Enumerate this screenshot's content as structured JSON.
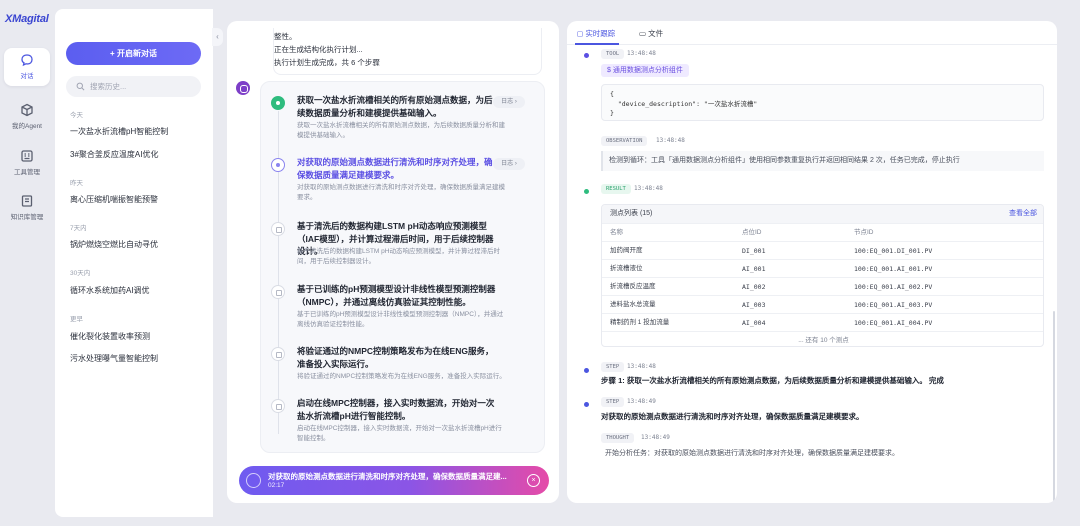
{
  "app": {
    "logo": "XMagital"
  },
  "rail": {
    "items": [
      {
        "label": "对话",
        "icon": "chat-icon",
        "active": true
      },
      {
        "label": "我的Agent",
        "icon": "cube-icon",
        "active": false
      },
      {
        "label": "工具管理",
        "icon": "toolbox-icon",
        "active": false
      },
      {
        "label": "知识库管理",
        "icon": "database-icon",
        "active": false
      }
    ]
  },
  "sidebar": {
    "new_chat_label": "+ 开启新对话",
    "search_placeholder": "搜索历史...",
    "groups": [
      {
        "title": "今天",
        "items": [
          "一次盐水折流槽pH智能控制",
          "3#聚合釜反应温度AI优化"
        ]
      },
      {
        "title": "昨天",
        "items": [
          "离心压缩机喘振智能预警"
        ]
      },
      {
        "title": "7天内",
        "items": [
          "锅炉燃烧空燃比自动寻优"
        ]
      },
      {
        "title": "30天内",
        "items": [
          "循环水系统加药AI调优"
        ]
      },
      {
        "title": "更早",
        "items": [
          "催化裂化装置收率预测",
          "污水处理曝气量智能控制"
        ]
      }
    ]
  },
  "center": {
    "top_message": [
      "整性。",
      "正在生成结构化执行计划...",
      "执行计划生成完成，共 6 个步骤"
    ],
    "log_label": "日志",
    "steps": [
      {
        "status": "done",
        "title": "获取一次盐水折流槽相关的所有原始测点数据，为后续数据质量分析和建模提供基础输入。",
        "desc": "获取一次盐水折流槽相关的所有原始测点数据，为后续数据质量分析和建模提供基础输入。"
      },
      {
        "status": "active",
        "title": "对获取的原始测点数据进行清洗和时序对齐处理，确保数据质量满足建模要求。",
        "desc": "对获取的原始测点数据进行清洗和时序对齐处理，确保数据质量满足建模要求。"
      },
      {
        "status": "pending",
        "title": "基于清洗后的数据构建LSTM pH动态响应预测模型（IAF模型），并计算过程滞后时间，用于后续控制器设计。",
        "desc": "基于清洗后的数据构建LSTM pH动态响应预测模型，并计算过程滞后时间，用于后续控制器设计。"
      },
      {
        "status": "pending",
        "title": "基于已训练的pH预测模型设计非线性模型预测控制器（NMPC），并通过离线仿真验证其控制性能。",
        "desc": "基于已训练的pH预测模型设计非线性模型预测控制器（NMPC），并通过离线仿真验证控制性能。"
      },
      {
        "status": "pending",
        "title": "将验证通过的NMPC控制策略发布为在线ENG服务，准备投入实际运行。",
        "desc": "将验证通过的NMPC控制策略发布为在线ENG服务，准备投入实际运行。"
      },
      {
        "status": "pending",
        "title": "启动在线MPC控制器，接入实时数据流，开始对一次盐水折流槽pH进行智能控制。",
        "desc": "启动在线MPC控制器，接入实时数据流，开始对一次盐水折流槽pH进行智能控制。"
      }
    ],
    "running": {
      "text": "对获取的原始测点数据进行清洗和时序对齐处理，确保数据质量满足建...",
      "elapsed": "02:17"
    }
  },
  "right": {
    "tabs": [
      {
        "label": "实时跟踪",
        "icon": "chat-icon",
        "active": true
      },
      {
        "label": "文件",
        "icon": "folder-icon",
        "active": false
      }
    ],
    "trace": {
      "tool": {
        "badge": "TOOL",
        "time": "13:48:48",
        "name": "$ 通用数据测点分析组件",
        "code": [
          "{",
          "  \"device_description\": \"一次盐水折流槽\"",
          "}"
        ]
      },
      "observation": {
        "badge": "OBSERVATION",
        "time": "13:48:48",
        "text": "检测到循环：工具「通用数据测点分析组件」使用相同参数重复执行并返回相同结果 2 次，任务已完成，停止执行"
      },
      "result": {
        "badge": "RESULT",
        "time": "13:48:48",
        "table_title": "测点列表 (15)",
        "view_all": "查看全部",
        "columns": [
          "名称",
          "点位ID",
          "节点ID"
        ],
        "rows": [
          [
            "加药阀开度",
            "DI_001",
            "100:EQ_001.DI_001.PV"
          ],
          [
            "折流槽液位",
            "AI_001",
            "100:EQ_001.AI_001.PV"
          ],
          [
            "折流槽反应温度",
            "AI_002",
            "100:EQ_001.AI_002.PV"
          ],
          [
            "进料盐水总流量",
            "AI_003",
            "100:EQ_001.AI_003.PV"
          ],
          [
            "精制药剂 1 投加流量",
            "AI_004",
            "100:EQ_001.AI_004.PV"
          ]
        ],
        "more": "... 还有 10 个测点"
      },
      "step1": {
        "badge": "STEP",
        "time": "13:48:48",
        "text": "步骤 1: 获取一次盐水折流槽相关的所有原始测点数据，为后续数据质量分析和建模提供基础输入。 完成"
      },
      "step2": {
        "badge": "STEP",
        "time": "13:48:49",
        "text": "对获取的原始测点数据进行清洗和时序对齐处理，确保数据质量满足建模要求。"
      },
      "thought": {
        "badge": "THOUGHT",
        "time": "13:48:49",
        "text": "开始分析任务：对获取的原始测点数据进行清洗和时序对齐处理，确保数据质量满足建模要求。"
      }
    }
  },
  "colors": {
    "accent": "#4b56e0",
    "success": "#2ebc7e",
    "tool_dot": "#5b4fe3"
  }
}
